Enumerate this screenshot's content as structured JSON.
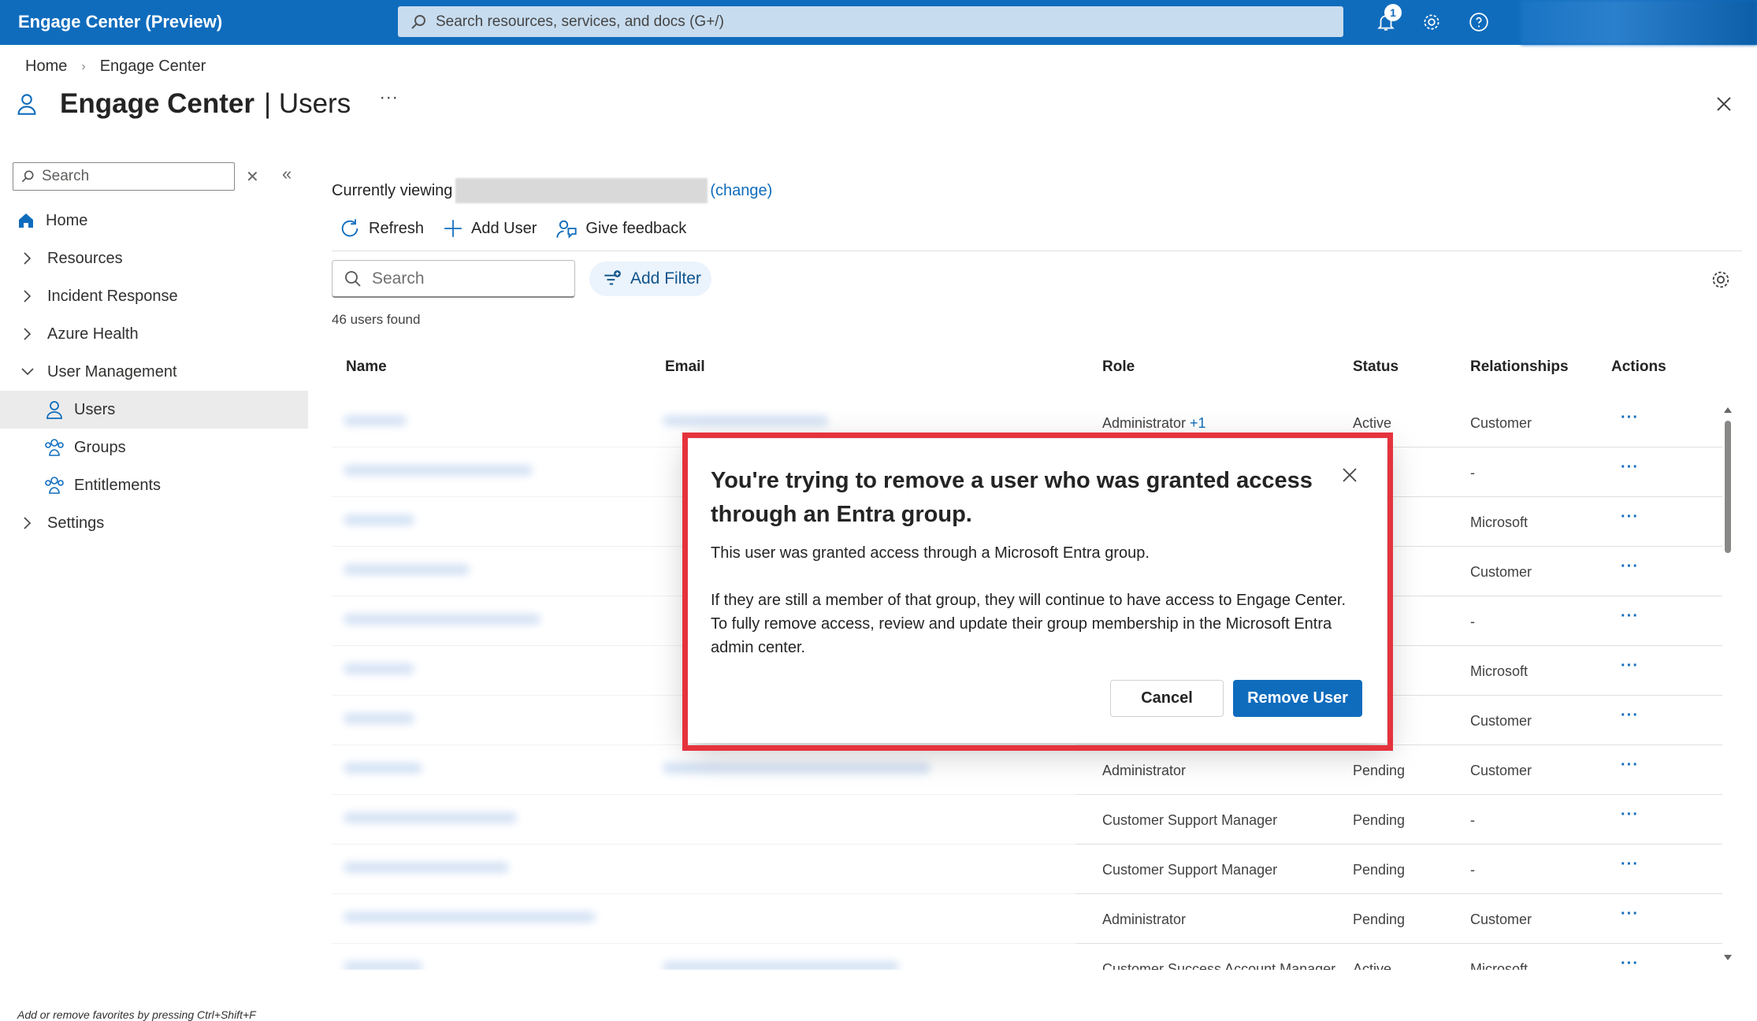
{
  "header": {
    "app_title": "Engage Center (Preview)",
    "search_placeholder": "Search resources, services, and docs (G+/)",
    "notification_count": "1"
  },
  "breadcrumb": [
    "Home",
    "Engage Center"
  ],
  "page": {
    "title": "Engage Center",
    "subtitle": "| Users",
    "more": "···"
  },
  "sidebar": {
    "search_placeholder": "Search",
    "items": [
      {
        "label": "Home"
      },
      {
        "label": "Resources"
      },
      {
        "label": "Incident Response"
      },
      {
        "label": "Azure Health"
      },
      {
        "label": "User Management"
      },
      {
        "label": "Users"
      },
      {
        "label": "Groups"
      },
      {
        "label": "Entitlements"
      },
      {
        "label": "Settings"
      }
    ],
    "footer_note": "Add or remove favorites by pressing Ctrl+Shift+F"
  },
  "main": {
    "viewing_label": "Currently viewing",
    "change_link": "(change)",
    "toolbar": {
      "refresh": "Refresh",
      "add_user": "Add User",
      "feedback": "Give feedback"
    },
    "search_placeholder": "Search",
    "add_filter": "Add Filter",
    "count_text": "46 users found"
  },
  "table": {
    "columns": [
      "Name",
      "Email",
      "Role",
      "Status",
      "Relationships",
      "Actions"
    ],
    "rows": [
      {
        "role": "Administrator",
        "role_extra": "+1",
        "status": "Active",
        "rel": "Customer"
      },
      {
        "role": "",
        "role_extra": "",
        "status": "g",
        "rel": "-"
      },
      {
        "role": "",
        "role_extra": "",
        "status": "",
        "rel": "Microsoft"
      },
      {
        "role": "",
        "role_extra": "",
        "status": "g",
        "rel": "Customer"
      },
      {
        "role": "",
        "role_extra": "",
        "status": "g",
        "rel": "-"
      },
      {
        "role": "",
        "role_extra": "",
        "status": "",
        "rel": "Microsoft"
      },
      {
        "role": "",
        "role_extra": "",
        "status": "",
        "rel": "Customer"
      },
      {
        "role": "Administrator",
        "role_extra": "",
        "status": "Pending",
        "rel": "Customer"
      },
      {
        "role": "Customer Support Manager",
        "role_extra": "",
        "status": "Pending",
        "rel": "-"
      },
      {
        "role": "Customer Support Manager",
        "role_extra": "",
        "status": "Pending",
        "rel": "-"
      },
      {
        "role": "Administrator",
        "role_extra": "",
        "status": "Pending",
        "rel": "Customer"
      },
      {
        "role": "Customer Success Account Manager",
        "role_extra": "",
        "status": "Active",
        "rel": "Microsoft"
      }
    ],
    "actions_label": "···"
  },
  "dialog": {
    "title": "You're trying to remove a user who was granted access through an Entra group.",
    "paragraph1": "This user was granted access through a Microsoft Entra group.",
    "paragraph2": "If they are still a member of that group, they will continue to have access to Engage Center. To fully remove access, review and update their group membership in the Microsoft Entra admin center.",
    "cancel": "Cancel",
    "confirm": "Remove User"
  },
  "colors": {
    "brand": "#0f6cbd",
    "highlight": "#e5333d"
  }
}
